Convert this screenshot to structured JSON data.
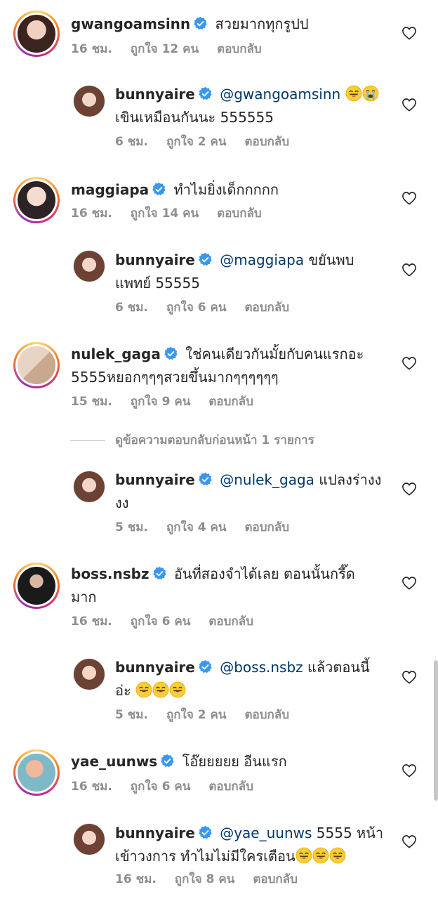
{
  "meta_labels": {
    "likes_prefix": "ถูกใจ",
    "likes_suffix": "คน",
    "reply": "ตอบกลับ"
  },
  "view_previous_replies": "ดูข้อความตอบกลับก่อนหน้า 1 รายการ",
  "icons": {
    "verified": "verified-badge-icon",
    "like": "heart-outline-icon",
    "emoji": "grinning-sweat-emoji"
  },
  "colors": {
    "verified": "#3897f0",
    "mention": "#00376b",
    "meta": "#8e8e8e"
  },
  "comments": [
    {
      "user": "gwangoamsinn",
      "text": "สวยมากทุกรูปป",
      "time": "16 ชม.",
      "likes": "12"
    },
    {
      "user": "bunnyaire",
      "mention": "@gwangoamsinn",
      "text": "เขินเหมือนกันนะ 555555",
      "time": "6 ชม.",
      "likes": "2"
    },
    {
      "user": "maggiapa",
      "text": "ทำไมยิ่งเด็กกกกก",
      "time": "16 ชม.",
      "likes": "14"
    },
    {
      "user": "bunnyaire",
      "mention": "@maggiapa",
      "text_line1": "ขยันพบ",
      "text_line2": "แพทย์ 55555",
      "time": "6 ชม.",
      "likes": "6"
    },
    {
      "user": "nulek_gaga",
      "text_line1": "ใช่คนเดียวกันมั้ยกับคนแรกอะ",
      "text_line2": "5555หยอกๆๆๆสวยขึ้นมากๆๆๆๆๆๆ",
      "time": "15 ชม.",
      "likes": "9"
    },
    {
      "user": "bunnyaire",
      "mention": "@nulek_gaga",
      "text_line1": "แปลงร่างง",
      "text_line2": "งง",
      "time": "5 ชม.",
      "likes": "4"
    },
    {
      "user": "boss.nsbz",
      "text_line1": "อันที่สองจำได้เลย ตอนนั้นกรี๊ด",
      "text_line2": "มาก",
      "time": "16 ชม.",
      "likes": "6"
    },
    {
      "user": "bunnyaire",
      "mention": "@boss.nsbz",
      "text_line1": "แล้วตอนนี้",
      "text_line2": "อ่ะ",
      "time": "5 ชม.",
      "likes": "2"
    },
    {
      "user": "yae_uunws",
      "text": "โอ๊ยยยยย อีนแรก",
      "time": "16 ชม.",
      "likes": "6"
    },
    {
      "user": "bunnyaire",
      "mention": "@yae_uunws",
      "text_line1": "5555 หน้า",
      "text_line2": "เข้าวงการ ทำไมไม่มีใครเตือน",
      "time": "16 ชม.",
      "likes": "8"
    }
  ]
}
